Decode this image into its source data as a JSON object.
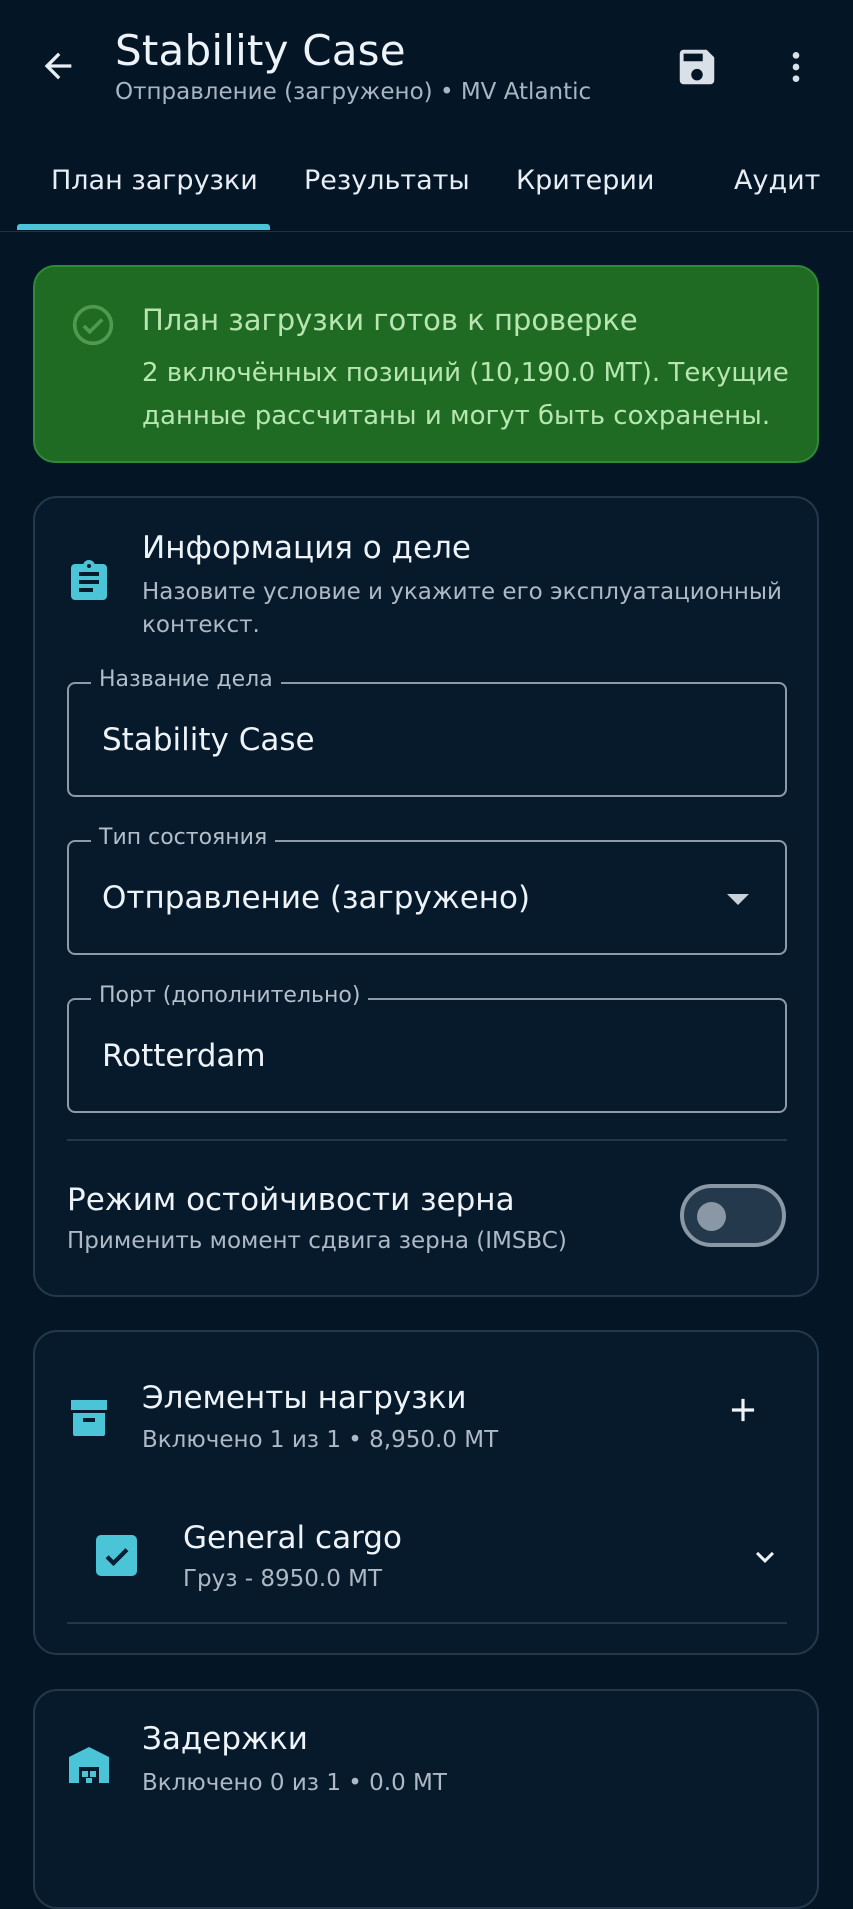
{
  "app_bar": {
    "title": "Stability Case",
    "subtitle": "Отправление (загружено) • MV Atlantic"
  },
  "tabs": [
    {
      "label": "План загрузки",
      "active": true
    },
    {
      "label": "Результаты"
    },
    {
      "label": "Критерии"
    },
    {
      "label": "Аудит"
    }
  ],
  "banner": {
    "title": "План загрузки готов к проверке",
    "text": "2 включённых позиций (10,190.0 МТ). Текущие данные рассчитаны и могут быть сохранены."
  },
  "case_info": {
    "title": "Информация о деле",
    "subtitle": "Назовите условие и укажите его эксплуатационный контекст.",
    "fields": {
      "case_name": {
        "label": "Название дела",
        "value": "Stability Case"
      },
      "condition_type": {
        "label": "Тип состояния",
        "value": "Отправление (загружено)"
      },
      "port": {
        "label": "Порт (дополнительно)",
        "value": "Rotterdam"
      }
    },
    "grain_mode": {
      "title": "Режим остойчивости зерна",
      "subtitle": "Применить момент сдвига зерна (IMSBC)",
      "enabled": false
    }
  },
  "load_items": {
    "title": "Элементы нагрузки",
    "subtitle": "Включено 1 из 1 • 8,950.0 МТ",
    "items": [
      {
        "name": "General cargo",
        "detail": "Груз - 8950.0 МТ",
        "checked": true
      }
    ]
  },
  "delays": {
    "title": "Задержки",
    "subtitle": "Включено 0 из 1 • 0.0 МТ"
  },
  "colors": {
    "background": "#041526",
    "accent": "#4cc4d8",
    "success_bg": "#1f6b24",
    "success_text": "#b7e6b0"
  },
  "icons": {
    "back": "arrow-left-icon",
    "save": "floppy-disk-icon",
    "more": "more-vertical-icon",
    "banner": "check-circle-icon",
    "case_info": "clipboard-icon",
    "load_items": "archive-box-icon",
    "delays": "warehouse-icon",
    "add": "plus-icon",
    "expand": "chevron-down-icon"
  }
}
